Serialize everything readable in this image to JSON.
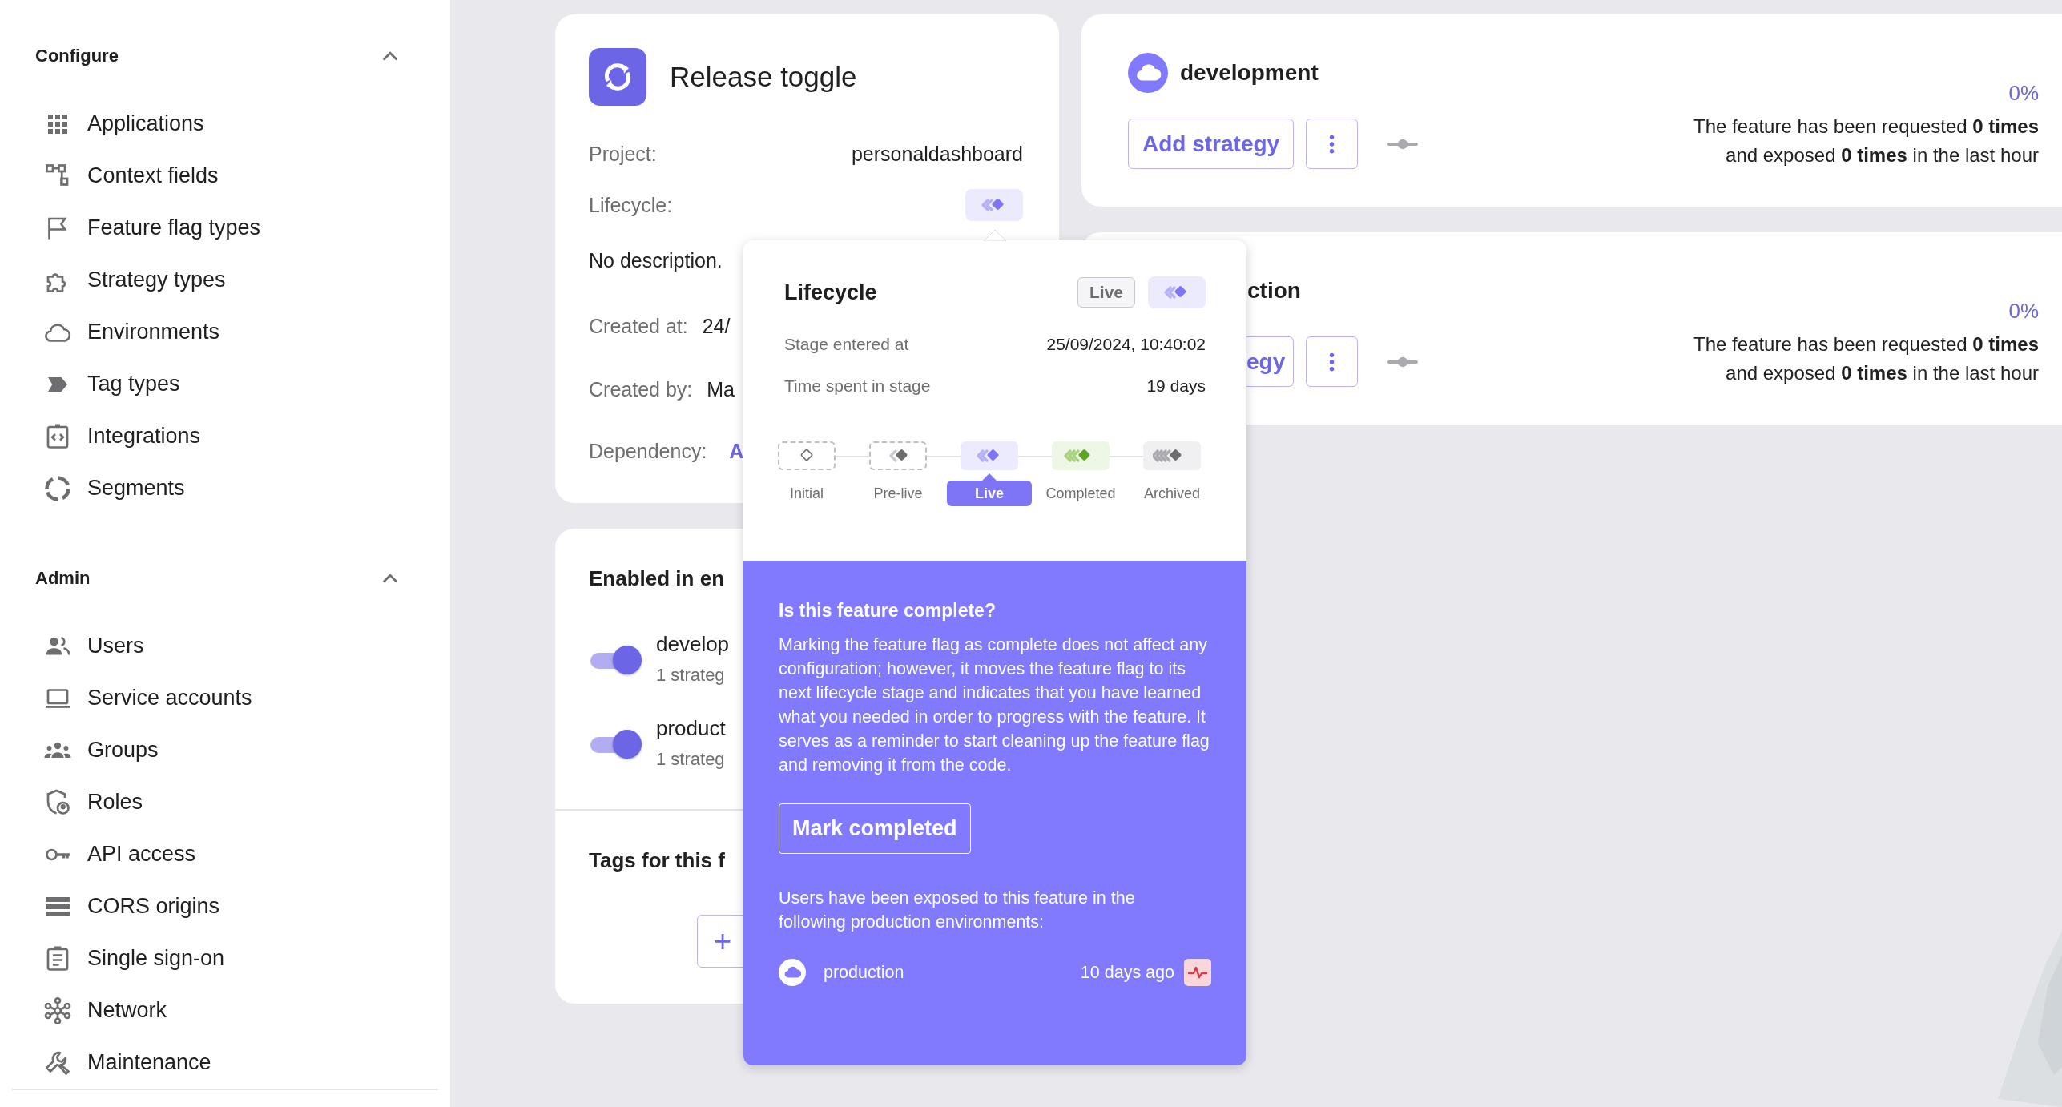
{
  "sidebar": {
    "sections": [
      {
        "title": "Configure",
        "expanded": true,
        "items": [
          "Applications",
          "Context fields",
          "Feature flag types",
          "Strategy types",
          "Environments",
          "Tag types",
          "Integrations",
          "Segments"
        ]
      },
      {
        "title": "Admin",
        "expanded": true,
        "items": [
          "Users",
          "Service accounts",
          "Groups",
          "Roles",
          "API access",
          "CORS origins",
          "Single sign-on",
          "Network",
          "Maintenance"
        ]
      }
    ]
  },
  "feature_card": {
    "title": "Release toggle",
    "project_label": "Project:",
    "project": "personaldashboard",
    "lifecycle_label": "Lifecycle:",
    "description": "No description.",
    "created_at_label": "Created at:",
    "created_at": "24/",
    "created_by_label": "Created by:",
    "created_by": "Ma",
    "dependency_label": "Dependency:",
    "dependency": "A"
  },
  "environments_card": {
    "title": "Enabled in en",
    "items": [
      {
        "name": "develop",
        "strategies": "1 strateg",
        "on": true
      },
      {
        "name": "product",
        "strategies": "1 strateg",
        "on": true
      }
    ],
    "tags_title": "Tags for this f",
    "add_tag_button": "+"
  },
  "development_card": {
    "name": "development",
    "add_strategy": "Add strategy",
    "percentage": "0%",
    "metrics": "The feature has been requested **0 times**\nand exposed **0 times** in the last hour"
  },
  "production_card": {
    "name": "ction",
    "add_strategy": "egy",
    "percentage": "0%",
    "metrics": "The feature has been requested **0 times**\nand exposed **0 times** in the last hour"
  },
  "lifecycle_popover": {
    "title": "Lifecycle",
    "stage_chip": "Live",
    "details": [
      {
        "label": "Stage entered at",
        "value": "25/09/2024, 10:40:02"
      },
      {
        "label": "Time spent in stage",
        "value": "19 days"
      }
    ],
    "stages": [
      {
        "label": "Initial",
        "kind": "initial",
        "selected": false
      },
      {
        "label": "Pre-live",
        "kind": "pre-live",
        "selected": false
      },
      {
        "label": "Live",
        "kind": "live",
        "selected": true
      },
      {
        "label": "Completed",
        "kind": "completed",
        "selected": false
      },
      {
        "label": "Archived",
        "kind": "archived",
        "selected": false
      }
    ],
    "prompt_title": "Is this feature complete?",
    "prompt_text": "Marking the feature flag as complete does not affect any configuration; however, it moves the feature flag to its next lifecycle stage and indicates that you have learned what you needed in order to progress with the feature. It serves as a reminder to start cleaning up the feature flag and removing it from the code.",
    "button": "Mark completed",
    "exposure_note": "Users have been exposed to this feature in the following production environments:",
    "environments": [
      {
        "name": "production",
        "time": "10 days ago"
      }
    ]
  }
}
